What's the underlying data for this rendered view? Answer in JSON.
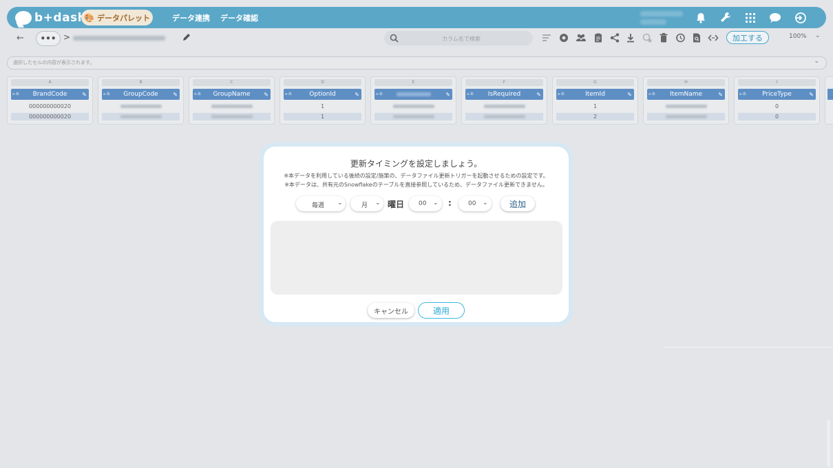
{
  "header": {
    "logo_text": "b+dash",
    "nav_active": "データパレット",
    "nav_links": [
      "データ連携",
      "データ確認"
    ]
  },
  "toolbar": {
    "back_symbol": "←",
    "more_symbol": "•••",
    "breadcrumb_separator": ">",
    "search_placeholder": "カラム名で検索",
    "process_label": "加工する",
    "zoom_value": "100%",
    "icons": [
      "filter-list-icon",
      "settings-icon",
      "users-icon",
      "clipboard-icon",
      "share-icon",
      "download-icon",
      "refresh-disabled-icon",
      "trash-icon",
      "history-icon",
      "file-search-icon",
      "code-icon"
    ]
  },
  "cell_bar": {
    "placeholder": "選択したセルの内容が表示されます。"
  },
  "grid": {
    "tag": "a-あ",
    "columns": [
      {
        "letter": "A",
        "name": "BrandCode",
        "r1": "000000000020",
        "r2": "000000000020"
      },
      {
        "letter": "B",
        "name": "GroupCode",
        "r1": "",
        "r2": ""
      },
      {
        "letter": "C",
        "name": "GroupName",
        "r1": "",
        "r2": ""
      },
      {
        "letter": "D",
        "name": "OptionId",
        "r1": "1",
        "r2": "1"
      },
      {
        "letter": "E",
        "name": "",
        "r1": "",
        "r2": ""
      },
      {
        "letter": "F",
        "name": "IsRequired",
        "r1": "",
        "r2": ""
      },
      {
        "letter": "G",
        "name": "ItemId",
        "r1": "1",
        "r2": "2"
      },
      {
        "letter": "H",
        "name": "ItemName",
        "r1": "",
        "r2": ""
      },
      {
        "letter": "I",
        "name": "PriceType",
        "r1": "0",
        "r2": "0"
      }
    ]
  },
  "modal": {
    "title": "更新タイミングを設定しましょう。",
    "note1": "※本データを利用している後続の設定/施策の、データファイル更新トリガーを起動させるための設定です。",
    "note2": "※本データは、共有元のSnowflakeのテーブルを直接参照しているため、データファイル更新できません。",
    "frequency": "毎週",
    "weekday": "月",
    "weekday_suffix": "曜日",
    "hour": "00",
    "colon": ":",
    "minute": "00",
    "add_label": "追加",
    "cancel_label": "キャンセル",
    "apply_label": "適用"
  },
  "colors": {
    "header_bg": "#5aa7c8",
    "column_header": "#5e8fc4",
    "accent": "#3db8e0"
  }
}
